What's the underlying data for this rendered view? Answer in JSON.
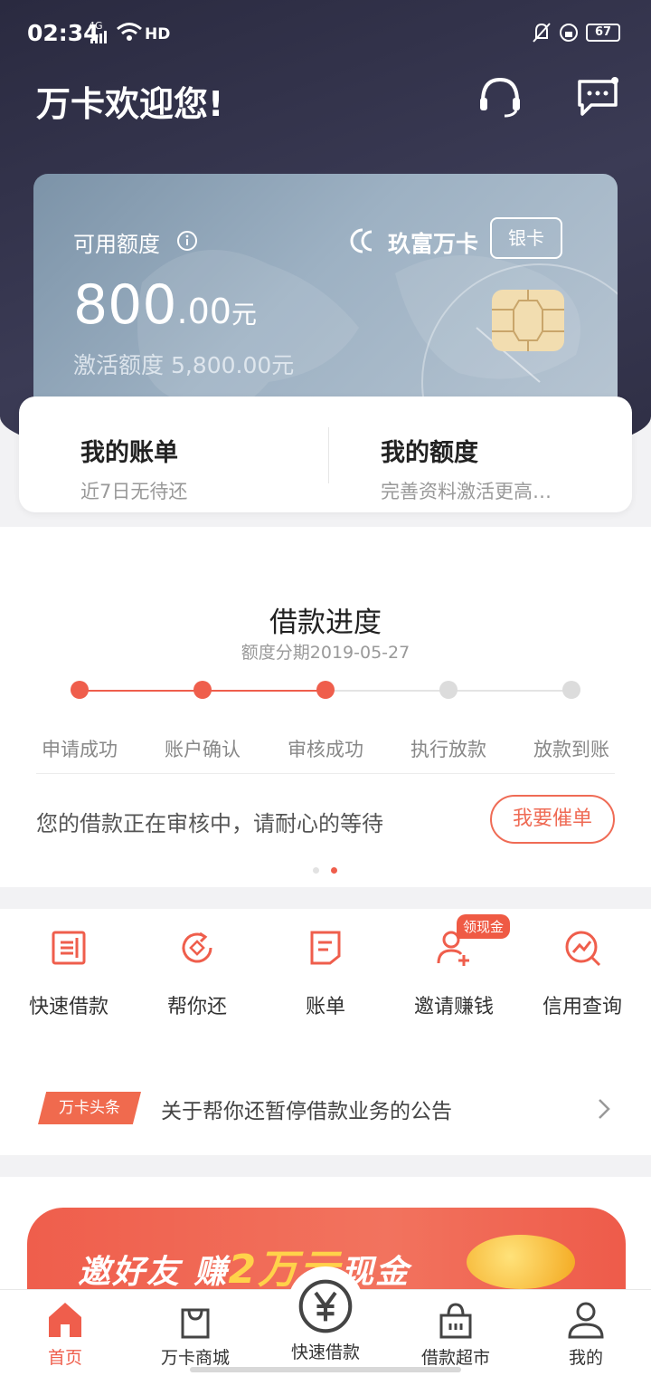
{
  "status_bar": {
    "time": "02:34",
    "network": "4G",
    "hd": "HD",
    "battery": "67"
  },
  "header": {
    "title": "万卡欢迎您!",
    "icons": [
      "headset-icon",
      "message-icon"
    ]
  },
  "card": {
    "label": "可用额度",
    "amount_int": "800",
    "amount_dec": ".00",
    "amount_unit": "元",
    "activate": "激活额度 5,800.00元",
    "brand": "玖富万卡",
    "tier": "银卡"
  },
  "summary": {
    "bill_title": "我的账单",
    "bill_sub": "近7日无待还",
    "limit_title": "我的额度",
    "limit_sub": "完善资料激活更高…"
  },
  "progress": {
    "title": "借款进度",
    "subtitle": "额度分期2019-05-27",
    "steps": [
      "申请成功",
      "账户确认",
      "审核成功",
      "执行放款",
      "放款到账"
    ],
    "completed_steps": 3,
    "message": "您的借款正在审核中，请耐心的等待",
    "urge_button": "我要催单",
    "pager_total": 2,
    "pager_active": 1
  },
  "quick_menu": {
    "items": [
      {
        "label": "快速借款",
        "icon": "loan-icon"
      },
      {
        "label": "帮你还",
        "icon": "repay-icon"
      },
      {
        "label": "账单",
        "icon": "bill-icon"
      },
      {
        "label": "邀请赚钱",
        "icon": "invite-icon"
      },
      {
        "label": "信用查询",
        "icon": "credit-icon"
      }
    ],
    "badge": "领现金"
  },
  "news": {
    "tag": "万卡头条",
    "text": "关于帮你还暂停借款业务的公告"
  },
  "banner": {
    "text_a": "邀好友 赚",
    "text_b": "2万元",
    "text_c": "现金"
  },
  "bottom_nav": {
    "items": [
      {
        "label": "首页",
        "icon": "home-icon",
        "active": true
      },
      {
        "label": "万卡商城",
        "icon": "shopping-bag-icon",
        "active": false
      },
      {
        "label": "快速借款",
        "icon": "yuan-icon",
        "active": false
      },
      {
        "label": "借款超市",
        "icon": "basket-icon",
        "active": false
      },
      {
        "label": "我的",
        "icon": "user-icon",
        "active": false
      }
    ]
  },
  "colors": {
    "accent": "#ef5e4c",
    "header_bg": "#33334b",
    "inactive_step": "#dcdcdc"
  }
}
